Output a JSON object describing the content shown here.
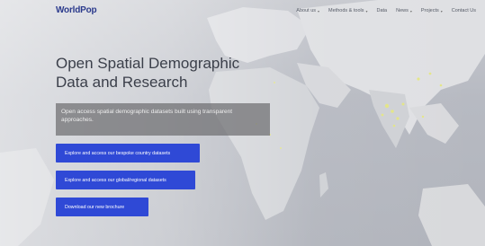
{
  "header": {
    "logo": "WorldPop",
    "nav": [
      {
        "label": "About us",
        "has_dropdown": true
      },
      {
        "label": "Methods & tools",
        "has_dropdown": true
      },
      {
        "label": "Data",
        "has_dropdown": false
      },
      {
        "label": "News",
        "has_dropdown": true
      },
      {
        "label": "Projects",
        "has_dropdown": true
      },
      {
        "label": "Contact Us",
        "has_dropdown": false
      }
    ]
  },
  "hero": {
    "title_line1": "Open Spatial Demographic",
    "title_line2": "Data and Research",
    "subtitle": "Open access spatial demographic datasets built using transparent approaches.",
    "buttons": [
      {
        "label": "Explore and access our bespoke country datasets"
      },
      {
        "label": "Explore and access our global/regional datasets"
      },
      {
        "label": "Download our new brochure"
      }
    ]
  },
  "icons": {
    "dropdown": "chevron-down-icon"
  },
  "colors": {
    "brand": "#2b3a8c",
    "button": "#2f49d6",
    "subtitle_bg": "#6e6e70"
  }
}
